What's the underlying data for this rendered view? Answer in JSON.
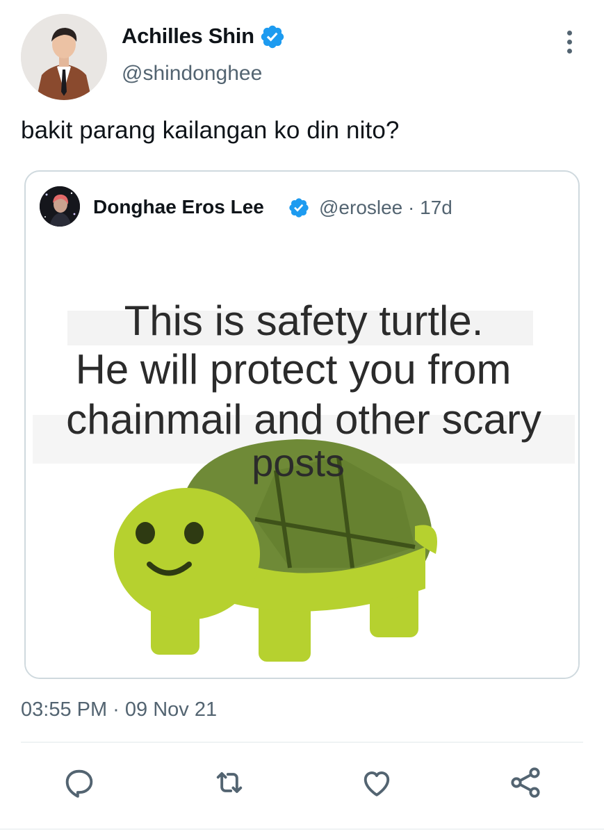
{
  "author": {
    "display_name": "Achilles Shin",
    "handle": "@shindonghee",
    "verified": true
  },
  "tweet": {
    "text": "bakit parang kailangan ko din nito?",
    "timestamp": "03:55 PM · 09 Nov 21"
  },
  "quoted_tweet": {
    "display_name": "Donghae Eros Lee",
    "handle": "@eroslee",
    "age": "17d",
    "meta": "@eroslee · 17d",
    "verified": true,
    "image_text": {
      "line1": "This is safety turtle.",
      "line2": "He will protect you from",
      "line3": "chainmail and other scary",
      "line4": "posts"
    }
  },
  "actions": {
    "icons": [
      "reply-icon",
      "retweet-icon",
      "like-icon",
      "share-icon"
    ]
  },
  "colors": {
    "verified_blue": "#1d9bf0",
    "secondary_text": "#536471",
    "border": "#cfd9de",
    "turtle_body": "#b6d12f",
    "turtle_shell": "#6f8a37"
  }
}
